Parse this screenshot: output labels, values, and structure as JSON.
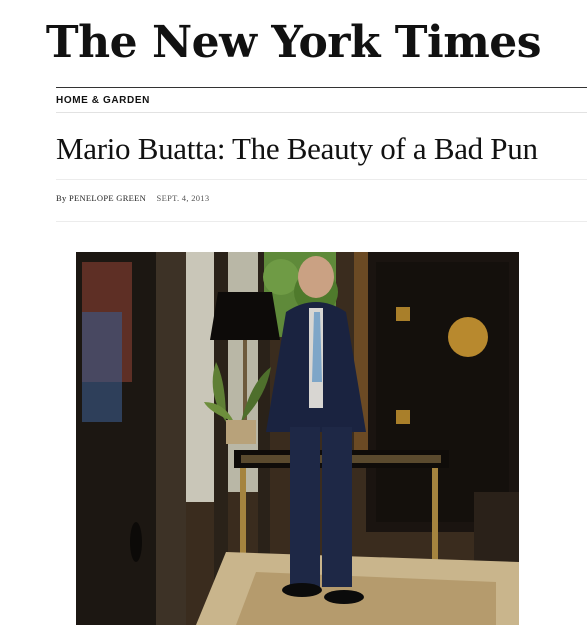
{
  "masthead": {
    "logo_text": "The New York Times"
  },
  "section": {
    "label": "HOME & GARDEN"
  },
  "article": {
    "headline": "Mario Buatta: The Beauty of a Bad Pun",
    "byline": "By PENELOPE GREEN",
    "date": "SEPT. 4, 2013"
  }
}
